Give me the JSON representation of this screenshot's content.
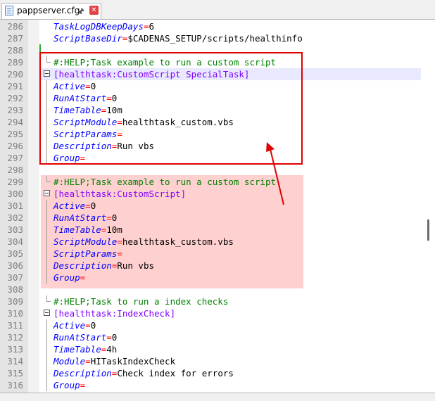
{
  "tab": {
    "title": "pappserver.cfg",
    "icon": "file-icon",
    "pin_icon": "pin-icon",
    "close_icon": "close-icon"
  },
  "editor": {
    "lines": [
      {
        "num": "286",
        "key": "TaskLogDBKeepDays",
        "value": "6"
      },
      {
        "num": "287",
        "key": "ScriptBaseDir",
        "value": "$CADENAS_SETUP/scripts/healthinfo"
      },
      {
        "num": "288"
      },
      {
        "num": "289",
        "comment": "#:HELP;Task example to run a custom script"
      },
      {
        "num": "290",
        "section": "[healthtask:CustomScript SpecialTask]"
      },
      {
        "num": "291",
        "key": "Active",
        "value": "0"
      },
      {
        "num": "292",
        "key": "RunAtStart",
        "value": "0"
      },
      {
        "num": "293",
        "key": "TimeTable",
        "value": "10m"
      },
      {
        "num": "294",
        "key": "ScriptModule",
        "value": "healthtask_custom.vbs"
      },
      {
        "num": "295",
        "key": "ScriptParams",
        "value": ""
      },
      {
        "num": "296",
        "key": "Description",
        "value": "Run vbs"
      },
      {
        "num": "297",
        "key": "Group",
        "value": ""
      },
      {
        "num": "298"
      },
      {
        "num": "299",
        "comment": "#:HELP;Task example to run a custom script"
      },
      {
        "num": "300",
        "section": "[healthtask:CustomScript]"
      },
      {
        "num": "301",
        "key": "Active",
        "value": "0"
      },
      {
        "num": "302",
        "key": "RunAtStart",
        "value": "0"
      },
      {
        "num": "303",
        "key": "TimeTable",
        "value": "10m"
      },
      {
        "num": "304",
        "key": "ScriptModule",
        "value": "healthtask_custom.vbs"
      },
      {
        "num": "305",
        "key": "ScriptParams",
        "value": ""
      },
      {
        "num": "306",
        "key": "Description",
        "value": "Run vbs"
      },
      {
        "num": "307",
        "key": "Group",
        "value": ""
      },
      {
        "num": "308"
      },
      {
        "num": "309",
        "comment": "#:HELP;Task to run a index checks"
      },
      {
        "num": "310",
        "section": "[healthtask:IndexCheck]"
      },
      {
        "num": "311",
        "key": "Active",
        "value": "0"
      },
      {
        "num": "312",
        "key": "RunAtStart",
        "value": "0"
      },
      {
        "num": "313",
        "key": "TimeTable",
        "value": "4h"
      },
      {
        "num": "314",
        "key": "Module",
        "value": "HITaskIndexCheck"
      },
      {
        "num": "315",
        "key": "Description",
        "value": "Check index for errors"
      },
      {
        "num": "316",
        "key": "Group",
        "value": ""
      }
    ]
  },
  "colors": {
    "key": "#0000ff",
    "equals": "#ff0000",
    "comment": "#008000",
    "section": "#8000ff",
    "highlight_box": "#e00000",
    "pink_fill": "#ffb3b3"
  }
}
